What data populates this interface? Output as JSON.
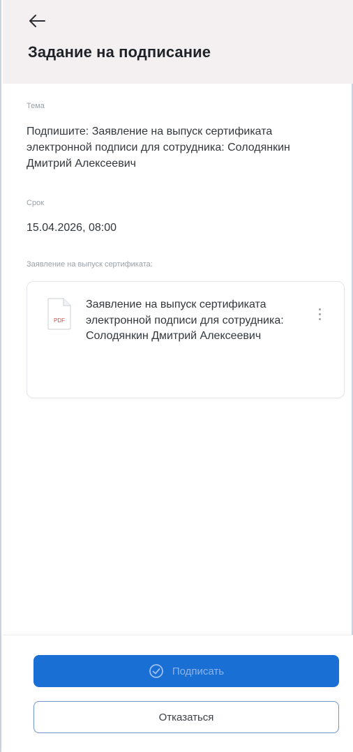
{
  "header": {
    "back_icon": "arrow-left-icon",
    "title": "Задание на подписание"
  },
  "fields": {
    "theme": {
      "label": "Тема",
      "value": "Подпишите: Заявление на выпуск сертификата электронной подписи для сотрудника: Солодянкин Дмитрий Алексеевич"
    },
    "deadline": {
      "label": "Срок",
      "value": "15.04.2026, 08:00"
    },
    "attachment": {
      "label": "Заявление на выпуск сертификата:"
    }
  },
  "document": {
    "icon": "pdf-file-icon",
    "icon_text": "PDF",
    "name": "Заявление на выпуск сертификата электронной подписи для сотрудника: Солодянкин Дмитрий Алексеевич",
    "menu_icon": "more-vertical-icon"
  },
  "actions": {
    "sign_label": "Подписать",
    "sign_icon": "check-circle-icon",
    "decline_label": "Отказаться"
  },
  "colors": {
    "header_bg": "#f4eff1",
    "primary": "#1a6fd4",
    "pdf_accent": "#e0483c"
  }
}
